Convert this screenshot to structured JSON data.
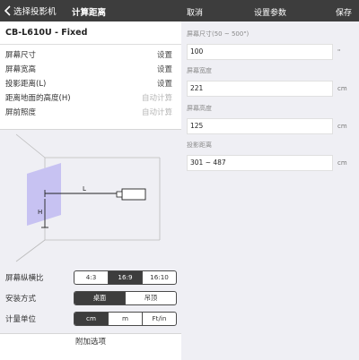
{
  "left_nav": {
    "back_label": "选择投影机",
    "title": "计算距离"
  },
  "model": "CB-L610U - Fixed",
  "rows": [
    {
      "label": "屏幕尺寸",
      "value": "设置"
    },
    {
      "label": "屏幕宽高",
      "value": "设置"
    },
    {
      "label": "投影距离(L)",
      "value": "设置"
    },
    {
      "label": "距离地面的高度(H)",
      "value": "自动计算"
    },
    {
      "label": "屏前照度",
      "value": "自动计算"
    }
  ],
  "diagram": {
    "label_l": "L",
    "label_h": "H"
  },
  "options": {
    "aspect": {
      "label": "屏幕纵横比",
      "options": [
        "4:3",
        "16:9",
        "16:10"
      ],
      "selected": "16:9"
    },
    "mount": {
      "label": "安装方式",
      "options": [
        "桌面",
        "吊顶"
      ],
      "selected": "桌面"
    },
    "unit": {
      "label": "计量单位",
      "options": [
        "cm",
        "m",
        "Ft/in"
      ],
      "selected": "cm"
    }
  },
  "footer": {
    "label": "附加选项"
  },
  "right_nav": {
    "cancel": "取消",
    "title": "设置参数",
    "save": "保存"
  },
  "fields": [
    {
      "label": "屏幕尺寸(50 ~ 500\")",
      "value": "100",
      "unit": "\""
    },
    {
      "label": "屏幕宽度",
      "value": "221",
      "unit": "cm"
    },
    {
      "label": "屏幕高度",
      "value": "125",
      "unit": "cm"
    },
    {
      "label": "投影距离",
      "value": "301 ~ 487",
      "unit": "cm"
    }
  ],
  "colors": {
    "nav_bg": "#3d3d3d",
    "screen_fill": "#c7c2f2",
    "accent": "#3d3d3d"
  }
}
